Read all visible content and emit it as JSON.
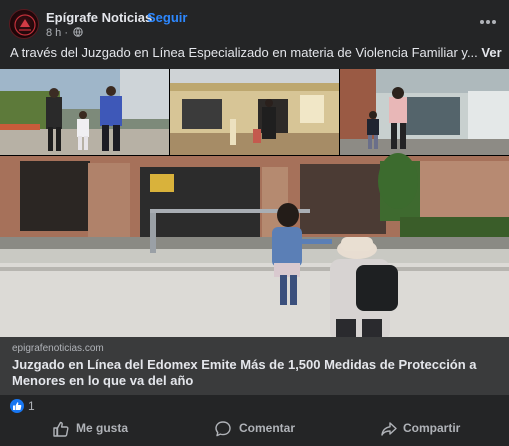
{
  "post": {
    "page_name": "Epígrafe Noticias",
    "separator": "·",
    "follow_label": "Seguir",
    "time": "8 h ·",
    "text": "A través del Juzgado en Línea Especializado en materia de Violencia Familiar y...",
    "see_more": "Ver más"
  },
  "link_preview": {
    "domain": "epigrafenoticias.com",
    "title": "Juzgado en Línea del Edomex Emite Más de 1,500 Medidas de Protección a Menores en lo que va del año"
  },
  "reactions": {
    "count": "1"
  },
  "actions": {
    "like": "Me gusta",
    "comment": "Comentar",
    "share": "Compartir"
  },
  "colors": {
    "background": "#242526",
    "link_box": "#3a3b3c",
    "accent": "#2d88ff",
    "like_badge": "#1877f2",
    "secondary_text": "#b0b3b8"
  },
  "icons": [
    "page-avatar",
    "globe-icon",
    "more-options-icon",
    "like-reaction-icon",
    "thumbs-up-icon",
    "comment-icon",
    "share-icon"
  ]
}
